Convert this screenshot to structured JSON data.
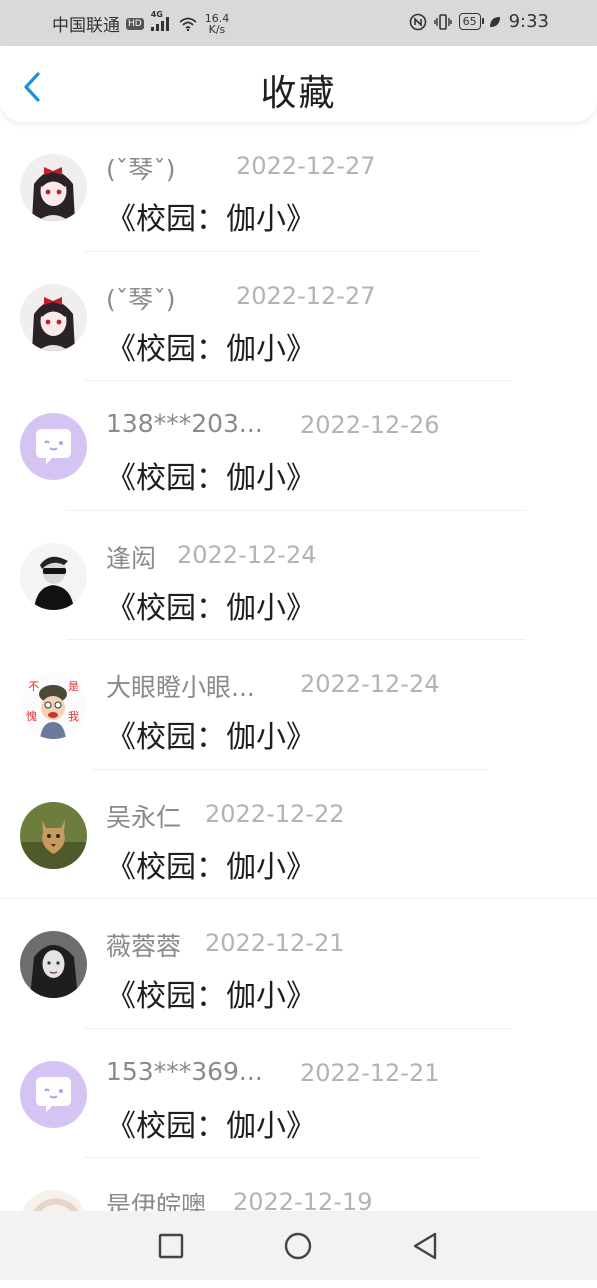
{
  "status_bar": {
    "carrier": "中国联通",
    "hd": "HD",
    "network": "4G",
    "speed_value": "16.4",
    "speed_unit": "K/s",
    "battery": "65",
    "time": "9:33"
  },
  "header": {
    "title": "收藏",
    "accent_color": "#1e90e0"
  },
  "items": [
    {
      "username": "(ˇ琴ˇ)",
      "date": "2022-12-27",
      "title": "《校园：伽小》",
      "avatar": "anime-girl-avatar"
    },
    {
      "username": "(ˇ琴ˇ)",
      "date": "2022-12-27",
      "title": "《校园：伽小》",
      "avatar": "anime-girl-avatar"
    },
    {
      "username": "138***203...",
      "date": "2022-12-26",
      "title": "《校园：伽小》",
      "avatar": "default-chat-avatar"
    },
    {
      "username": "逢闳",
      "date": "2022-12-24",
      "title": "《校园：伽小》",
      "avatar": "sunglasses-person-avatar"
    },
    {
      "username": "大眼瞪小眼...",
      "date": "2022-12-24",
      "title": "《校园：伽小》",
      "avatar": "cartoon-soldier-avatar"
    },
    {
      "username": "吴永仁",
      "date": "2022-12-22",
      "title": "《校园：伽小》",
      "avatar": "cougar-avatar"
    },
    {
      "username": "薇蓉蓉",
      "date": "2022-12-21",
      "title": "《校园：伽小》",
      "avatar": "dark-girl-avatar"
    },
    {
      "username": "153***369...",
      "date": "2022-12-21",
      "title": "《校园：伽小》",
      "avatar": "default-chat-avatar"
    },
    {
      "username": "是伊皖噢",
      "date": "2022-12-19",
      "title": "",
      "avatar": "light-avatar"
    }
  ],
  "nav": {
    "recents_icon": "square-icon",
    "home_icon": "circle-icon",
    "back_icon": "triangle-icon"
  }
}
